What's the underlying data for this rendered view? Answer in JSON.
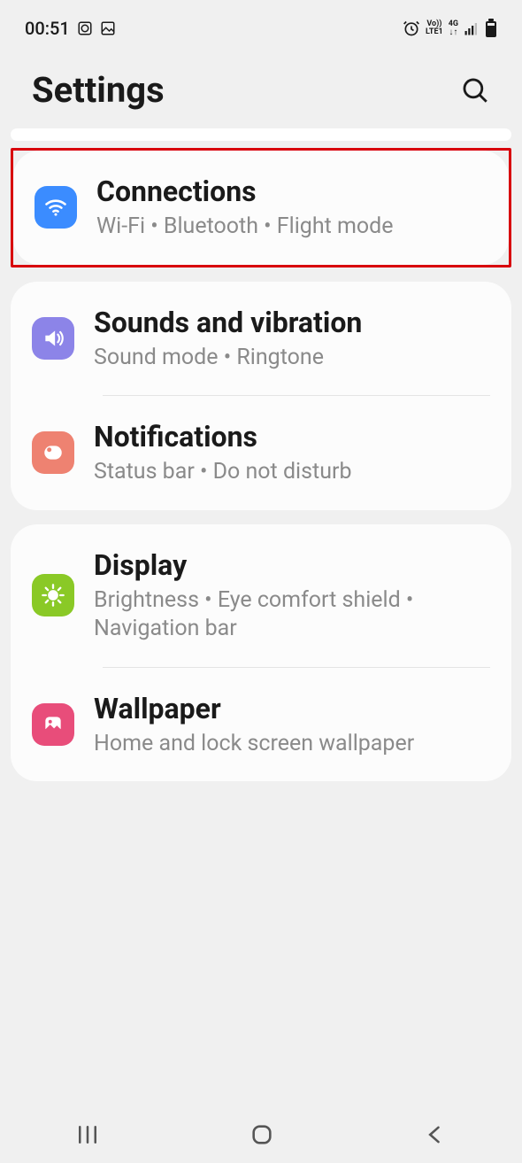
{
  "status": {
    "time": "00:51",
    "net1": "Vo))",
    "net2": "LTE1",
    "net3": "4G"
  },
  "header": {
    "title": "Settings"
  },
  "groups": [
    {
      "highlighted": true,
      "items": [
        {
          "icon": "wifi",
          "title": "Connections",
          "sub": "Wi‑Fi  •  Bluetooth  •  Flight mode"
        }
      ]
    },
    {
      "items": [
        {
          "icon": "sound",
          "title": "Sounds and vibration",
          "sub": "Sound mode  •  Ringtone"
        },
        {
          "icon": "notif",
          "title": "Notifications",
          "sub": "Status bar  •  Do not disturb"
        }
      ]
    },
    {
      "items": [
        {
          "icon": "display",
          "title": "Display",
          "sub": "Brightness  •  Eye comfort shield  •  Navigation bar"
        },
        {
          "icon": "wallpaper",
          "title": "Wallpaper",
          "sub": "Home and lock screen wallpaper"
        }
      ]
    }
  ]
}
